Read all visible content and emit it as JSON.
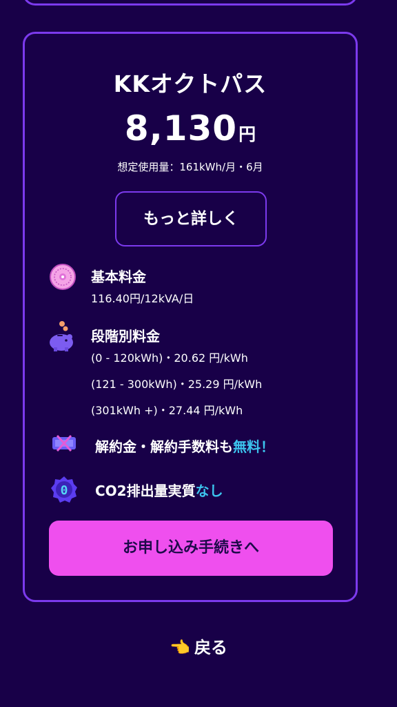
{
  "plan": {
    "name": "KKオクトパス",
    "price_amount": "8,130",
    "price_unit": "円",
    "usage_note": "想定使用量：161kWh/月・6月",
    "more_button": "もっと詳しく"
  },
  "fees": {
    "basic": {
      "icon": "meter-icon",
      "title": "基本料金",
      "value": "116.40円/12kVA/日"
    },
    "tiered": {
      "icon": "piggy-bank-icon",
      "title": "段階別料金",
      "tiers": [
        "(0 - 120kWh)・20.62 円/kWh",
        "(121 - 300kWh)・25.29 円/kWh",
        "(301kWh +)・27.44 円/kWh"
      ]
    }
  },
  "promos": {
    "cancellation": {
      "icon": "crossed-ticket-icon",
      "text": "解約金・解約手数料も",
      "highlight": "無料！"
    },
    "co2": {
      "icon": "zero-badge-icon",
      "text": "CO2排出量実質",
      "highlight": "なし"
    }
  },
  "apply_button": "お申し込み手続きへ",
  "back_link": {
    "icon": "pointing-hand-icon",
    "emoji": "👈",
    "label": "戻る"
  },
  "colors": {
    "background": "#180048",
    "border": "#7c3aed",
    "highlight": "#3cc4ee",
    "apply_button": "#ef4fee"
  }
}
